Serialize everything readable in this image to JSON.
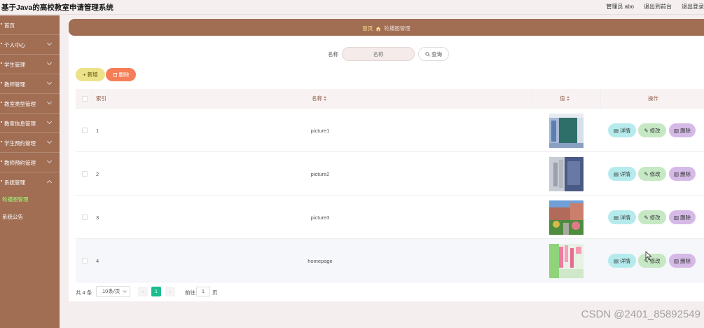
{
  "app": {
    "title": "基于Java的高校教室申请管理系统",
    "admin_label": "管理员 abo",
    "exit_front": "退出到前台",
    "logout": "退出登录"
  },
  "sidebar": {
    "items": [
      {
        "label": "首页",
        "has_arrow": false
      },
      {
        "label": "个人中心",
        "has_arrow": true
      },
      {
        "label": "学生管理",
        "has_arrow": true
      },
      {
        "label": "教师管理",
        "has_arrow": true
      },
      {
        "label": "教室类型管理",
        "has_arrow": true
      },
      {
        "label": "教室信息管理",
        "has_arrow": true
      },
      {
        "label": "学生预约管理",
        "has_arrow": true
      },
      {
        "label": "教师预约管理",
        "has_arrow": true
      },
      {
        "label": "系统管理",
        "has_arrow": true
      }
    ],
    "subitems": [
      {
        "label": "轮播图管理",
        "active": true
      },
      {
        "label": "系统公告",
        "active": false
      }
    ]
  },
  "breadcrumb": {
    "home": "首页",
    "current": "轮播图管理"
  },
  "search": {
    "label": "名称",
    "placeholder": "名称",
    "button": "查询"
  },
  "actions": {
    "add": "新增",
    "delete": "删除"
  },
  "table": {
    "headers": {
      "index": "索引",
      "name": "名称",
      "value": "值",
      "ops": "操作"
    },
    "rows": [
      {
        "index": "1",
        "name": "picture1",
        "thumb": "corridor"
      },
      {
        "index": "2",
        "name": "picture2",
        "thumb": "building"
      },
      {
        "index": "3",
        "name": "picture3",
        "thumb": "garden"
      },
      {
        "index": "4",
        "name": "homepage",
        "thumb": "banner"
      }
    ],
    "row_buttons": {
      "detail": "详情",
      "edit": "修改",
      "remove": "删除"
    }
  },
  "pagination": {
    "total": "共 4 条",
    "page_size": "10条/页",
    "current_page": "1",
    "goto_prefix": "前往",
    "goto_value": "1",
    "goto_suffix": "页"
  },
  "watermark": "CSDN @2401_85892549",
  "colors": {
    "brand": "#a16e54",
    "active_sub": "#9bff6f",
    "page_active": "#1bbd8e",
    "add": "#ece28a",
    "delete": "#f57e58",
    "detail": "#b6ebed",
    "edit": "#c6e8c4",
    "remove": "#d5b9e6"
  }
}
